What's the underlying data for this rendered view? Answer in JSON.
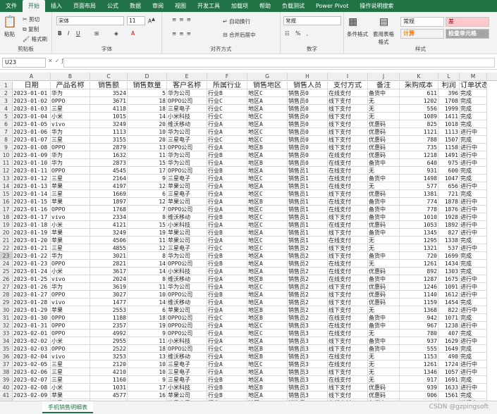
{
  "menu": [
    "文件",
    "开始",
    "插入",
    "页面布局",
    "公式",
    "数据",
    "审阅",
    "视图",
    "开发工具",
    "加载项",
    "帮助",
    "负载测试",
    "Power Pivot",
    "操作说明搜索"
  ],
  "ribbon": {
    "paste": "粘贴",
    "cut": "剪切",
    "copy": "复制",
    "format_painter": "格式刷",
    "clipboard": "剪贴板",
    "font_name": "宋体",
    "font_size": "11",
    "font": "字体",
    "wrap": "自动换行",
    "merge": "合并后居中",
    "alignment": "对齐方式",
    "number_format": "常规",
    "number": "数字",
    "cond_format": "条件格式",
    "table_format": "套用表格格式",
    "style_normal": "常规",
    "style_bad": "差",
    "style_calc": "计算",
    "style_check": "检查单元格",
    "styles": "样式"
  },
  "name_box": "U23",
  "headers": [
    "日期",
    "产品名称",
    "销售额",
    "销售数量",
    "客户名称",
    "所属行业",
    "销售地区",
    "销售人员",
    "支付方式",
    "备注",
    "采购成本",
    "利润",
    "订单状态"
  ],
  "columns": [
    "A",
    "B",
    "C",
    "D",
    "E",
    "F",
    "G",
    "H",
    "I",
    "J",
    "K",
    "L",
    "M"
  ],
  "rows": [
    [
      "2023-01-01",
      "华为",
      "3524",
      "5",
      "华为公司",
      "行业B",
      "地区C",
      "销售员0",
      "在线支付",
      "备货中",
      "611",
      "396",
      "完成"
    ],
    [
      "2023-01-02",
      "OPPO",
      "3671",
      "18",
      "OPPO公司",
      "行业C",
      "地区A",
      "销售员0",
      "线下支付",
      "无",
      "1202",
      "1708",
      "完成"
    ],
    [
      "2023-01-03",
      "三星",
      "4118",
      "18",
      "三星电子",
      "行业C",
      "地区A",
      "销售员0",
      "线下支付",
      "无",
      "556",
      "1999",
      "完成"
    ],
    [
      "2023-01-04",
      "小米",
      "1015",
      "14",
      "小米科技",
      "行业C",
      "地区C",
      "销售员0",
      "线下支付",
      "无",
      "1089",
      "1411",
      "完成"
    ],
    [
      "2023-01-05",
      "vivo",
      "3249",
      "20",
      "维沃移动",
      "行业A",
      "地区A",
      "销售员0",
      "线下支付",
      "优惠码",
      "825",
      "1018",
      "完成"
    ],
    [
      "2023-01-06",
      "华为",
      "1113",
      "10",
      "华为公司",
      "行业A",
      "地区C",
      "销售员0",
      "线下支付",
      "优惠码",
      "1121",
      "1113",
      "进行中"
    ],
    [
      "2023-01-07",
      "三星",
      "3155",
      "20",
      "三星电子",
      "行业C",
      "地区C",
      "销售员0",
      "线下支付",
      "优惠码",
      "788",
      "1507",
      "完成"
    ],
    [
      "2023-01-08",
      "OPPO",
      "2879",
      "13",
      "OPPO公司",
      "行业A",
      "地区B",
      "销售员0",
      "线下支付",
      "优惠码",
      "735",
      "1158",
      "进行中"
    ],
    [
      "2023-01-09",
      "华为",
      "1632",
      "11",
      "华为公司",
      "行业B",
      "地区A",
      "销售员0",
      "在线支付",
      "优惠码",
      "1218",
      "1491",
      "进行中"
    ],
    [
      "2023-01-10",
      "华为",
      "2873",
      "15",
      "华为公司",
      "行业A",
      "地区B",
      "销售员0",
      "在线支付",
      "备货中",
      "640",
      "975",
      "进行中"
    ],
    [
      "2023-01-11",
      "OPPO",
      "4545",
      "17",
      "OPPO公司",
      "行业B",
      "地区A",
      "销售员1",
      "在线支付",
      "无",
      "931",
      "600",
      "完成"
    ],
    [
      "2023-01-12",
      "三星",
      "2164",
      "9",
      "三星电子",
      "行业A",
      "地区C",
      "销售员1",
      "在线支付",
      "备货中",
      "1498",
      "1047",
      "完成"
    ],
    [
      "2023-01-13",
      "苹果",
      "4197",
      "12",
      "苹果公司",
      "行业A",
      "地区A",
      "销售员1",
      "在线支付",
      "无",
      "577",
      "656",
      "进行中"
    ],
    [
      "2023-01-14",
      "三星",
      "1669",
      "6",
      "三星电子",
      "行业A",
      "地区C",
      "销售员1",
      "线下支付",
      "优惠码",
      "1381",
      "721",
      "完成"
    ],
    [
      "2023-01-15",
      "苹果",
      "1897",
      "12",
      "苹果公司",
      "行业A",
      "地区B",
      "销售员1",
      "在线支付",
      "备货中",
      "774",
      "1878",
      "进行中"
    ],
    [
      "2023-01-16",
      "OPPO",
      "1768",
      "7",
      "OPPO公司",
      "行业A",
      "地区C",
      "销售员1",
      "在线支付",
      "备货中",
      "778",
      "1876",
      "进行中"
    ],
    [
      "2023-01-17",
      "vivo",
      "2334",
      "8",
      "维沃移动",
      "行业B",
      "地区C",
      "销售员1",
      "线下支付",
      "备货中",
      "1010",
      "1928",
      "进行中"
    ],
    [
      "2023-01-18",
      "小米",
      "4121",
      "15",
      "小米科技",
      "行业A",
      "地区C",
      "销售员1",
      "在线支付",
      "优惠码",
      "1053",
      "1892",
      "进行中"
    ],
    [
      "2023-01-19",
      "苹果",
      "3249",
      "19",
      "苹果公司",
      "行业B",
      "地区A",
      "销售员1",
      "线下支付",
      "备货中",
      "1345",
      "827",
      "进行中"
    ],
    [
      "2023-01-20",
      "苹果",
      "4506",
      "11",
      "苹果公司",
      "行业A",
      "地区C",
      "销售员1",
      "在线支付",
      "无",
      "1295",
      "1338",
      "完成"
    ],
    [
      "2023-01-21",
      "三星",
      "4855",
      "12",
      "三星电子",
      "行业C",
      "地区C",
      "销售员2",
      "线下支付",
      "无",
      "1321",
      "537",
      "进行中"
    ],
    [
      "2023-01-22",
      "华为",
      "3021",
      "8",
      "华为公司",
      "行业B",
      "地区A",
      "销售员2",
      "线下支付",
      "备货中",
      "720",
      "1699",
      "完成"
    ],
    [
      "2023-01-23",
      "OPPO",
      "2821",
      "14",
      "OPPO公司",
      "行业B",
      "地区A",
      "销售员2",
      "在线支付",
      "无",
      "1261",
      "1434",
      "完成"
    ],
    [
      "2023-01-24",
      "小米",
      "3617",
      "14",
      "小米科技",
      "行业A",
      "地区A",
      "销售员2",
      "在线支付",
      "优惠码",
      "892",
      "1303",
      "完成"
    ],
    [
      "2023-01-25",
      "vivo",
      "2024",
      "8",
      "维沃移动",
      "行业A",
      "地区B",
      "销售员2",
      "在线支付",
      "备货中",
      "1287",
      "1675",
      "进行中"
    ],
    [
      "2023-01-26",
      "华为",
      "3619",
      "11",
      "华为公司",
      "行业A",
      "地区C",
      "销售员2",
      "线下支付",
      "优惠码",
      "1246",
      "1091",
      "进行中"
    ],
    [
      "2023-01-27",
      "OPPO",
      "3027",
      "10",
      "OPPO公司",
      "行业B",
      "地区A",
      "销售员2",
      "线下支付",
      "优惠码",
      "1140",
      "1612",
      "进行中"
    ],
    [
      "2023-01-28",
      "vivo",
      "1477",
      "14",
      "维沃移动",
      "行业A",
      "地区A",
      "销售员2",
      "线下支付",
      "优惠码",
      "1159",
      "1454",
      "完成"
    ],
    [
      "2023-01-29",
      "苹果",
      "2553",
      "6",
      "苹果公司",
      "行业A",
      "地区B",
      "销售员2",
      "线下支付",
      "无",
      "1368",
      "822",
      "进行中"
    ],
    [
      "2023-01-30",
      "OPPO",
      "1188",
      "18",
      "OPPO公司",
      "行业C",
      "地区B",
      "销售员2",
      "在线支付",
      "备货中",
      "942",
      "1071",
      "完成"
    ],
    [
      "2023-01-31",
      "OPPO",
      "2357",
      "19",
      "OPPO公司",
      "行业A",
      "地区C",
      "销售员3",
      "在线支付",
      "备货中",
      "967",
      "1238",
      "进行中"
    ],
    [
      "2023-02-01",
      "OPPO",
      "4992",
      "9",
      "OPPO公司",
      "行业A",
      "地区C",
      "销售员3",
      "在线支付",
      "无",
      "780",
      "407",
      "完成"
    ],
    [
      "2023-02-02",
      "小米",
      "2955",
      "11",
      "小米科技",
      "行业A",
      "地区A",
      "销售员3",
      "线下支付",
      "备货中",
      "937",
      "1629",
      "进行中"
    ],
    [
      "2023-02-03",
      "OPPO",
      "2522",
      "18",
      "OPPO公司",
      "行业C",
      "地区B",
      "销售员3",
      "线下支付",
      "备货中",
      "555",
      "1649",
      "完成"
    ],
    [
      "2023-02-04",
      "vivo",
      "3253",
      "13",
      "维沃移动",
      "行业A",
      "地区B",
      "销售员3",
      "在线支付",
      "无",
      "1153",
      "498",
      "完成"
    ],
    [
      "2023-02-05",
      "三星",
      "2120",
      "10",
      "三星电子",
      "行业A",
      "地区C",
      "销售员3",
      "在线支付",
      "无",
      "1261",
      "1724",
      "进行中"
    ],
    [
      "2023-02-06",
      "三星",
      "4210",
      "10",
      "三星电子",
      "行业A",
      "地区A",
      "销售员3",
      "线下支付",
      "无",
      "1346",
      "1057",
      "进行中"
    ],
    [
      "2023-02-07",
      "三星",
      "1160",
      "9",
      "三星电子",
      "行业B",
      "地区A",
      "销售员3",
      "在线支付",
      "无",
      "917",
      "1691",
      "完成"
    ],
    [
      "2023-02-08",
      "小米",
      "1031",
      "17",
      "小米科技",
      "行业B",
      "地区B",
      "销售员3",
      "线下支付",
      "优惠码",
      "939",
      "1633",
      "进行中"
    ],
    [
      "2023-02-09",
      "苹果",
      "4577",
      "16",
      "苹果公司",
      "行业B",
      "地区A",
      "销售员3",
      "线下支付",
      "优惠码",
      "906",
      "1561",
      "完成"
    ],
    [
      "2023-02-10",
      "三星",
      "1500",
      "18",
      "三星电子",
      "行业A",
      "地区C",
      "销售员3",
      "在线支付",
      "备货中",
      "1014",
      "912",
      "进行中"
    ]
  ],
  "sheet_tab": "手机销售明细表",
  "watermark": "CSDN @gzpingsoft"
}
